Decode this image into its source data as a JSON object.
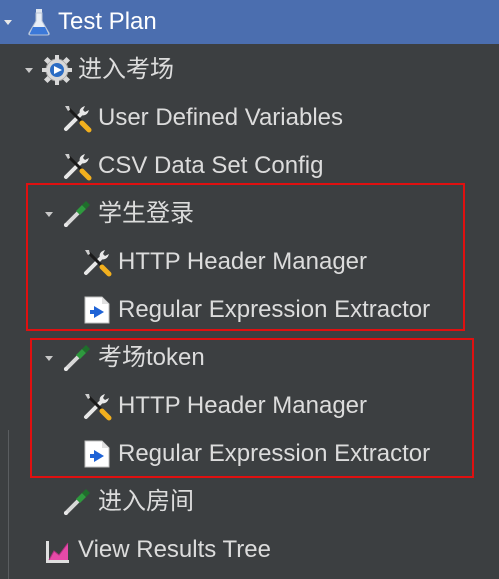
{
  "tree": {
    "root": {
      "label": "Test Plan",
      "icon": "test-plan-flask-icon"
    },
    "group": {
      "label": "进入考场",
      "icon": "thread-group-gear-icon"
    },
    "config1": {
      "label": "User Defined Variables",
      "icon": "config-wrench-icon"
    },
    "config2": {
      "label": "CSV Data Set Config",
      "icon": "config-wrench-icon"
    },
    "sampler1": {
      "label": "学生登录",
      "icon": "sampler-pipette-icon"
    },
    "sampler1_child1": {
      "label": "HTTP Header Manager",
      "icon": "config-wrench-icon"
    },
    "sampler1_child2": {
      "label": "Regular Expression Extractor",
      "icon": "extractor-document-icon"
    },
    "sampler2": {
      "label": "考场token",
      "icon": "sampler-pipette-icon"
    },
    "sampler2_child1": {
      "label": "HTTP Header Manager",
      "icon": "config-wrench-icon"
    },
    "sampler2_child2": {
      "label": "Regular Expression Extractor",
      "icon": "extractor-document-icon"
    },
    "sampler3": {
      "label": "进入房间",
      "icon": "sampler-pipette-icon"
    },
    "listener": {
      "label": "View Results Tree",
      "icon": "listener-chart-icon"
    }
  },
  "colors": {
    "background": "#3c3f41",
    "selection": "#4b6eaf",
    "highlight_box": "#e01010",
    "text": "#dcdcdc"
  }
}
